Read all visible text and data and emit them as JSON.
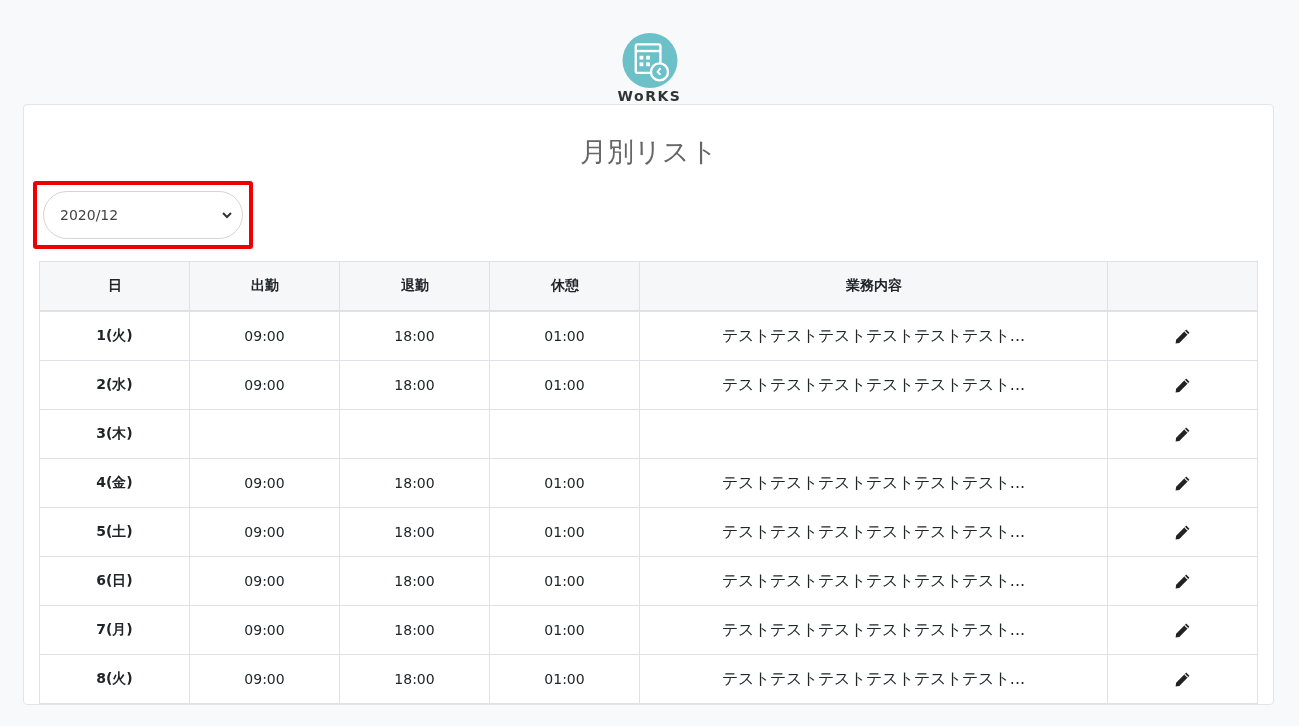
{
  "logo": {
    "text": "WoRKS"
  },
  "title": "月別リスト",
  "month_select": {
    "value": "2020/12",
    "highlighted": true
  },
  "table": {
    "columns": [
      "日",
      "出勤",
      "退勤",
      "休憩",
      "業務内容"
    ],
    "rows": [
      {
        "day": "1(火)",
        "start": "09:00",
        "end": "18:00",
        "break": "01:00",
        "work": "テストテストテストテストテストテスト..."
      },
      {
        "day": "2(水)",
        "start": "09:00",
        "end": "18:00",
        "break": "01:00",
        "work": "テストテストテストテストテストテスト..."
      },
      {
        "day": "3(木)"
      },
      {
        "day": "4(金)",
        "start": "09:00",
        "end": "18:00",
        "break": "01:00",
        "work": "テストテストテストテストテストテスト..."
      },
      {
        "day": "5(土)",
        "start": "09:00",
        "end": "18:00",
        "break": "01:00",
        "work": "テストテストテストテストテストテスト..."
      },
      {
        "day": "6(日)",
        "start": "09:00",
        "end": "18:00",
        "break": "01:00",
        "work": "テストテストテストテストテストテスト..."
      },
      {
        "day": "7(月)",
        "start": "09:00",
        "end": "18:00",
        "break": "01:00",
        "work": "テストテストテストテストテストテスト..."
      },
      {
        "day": "8(火)",
        "start": "09:00",
        "end": "18:00",
        "break": "01:00",
        "work": "テストテストテストテストテストテスト..."
      }
    ]
  }
}
